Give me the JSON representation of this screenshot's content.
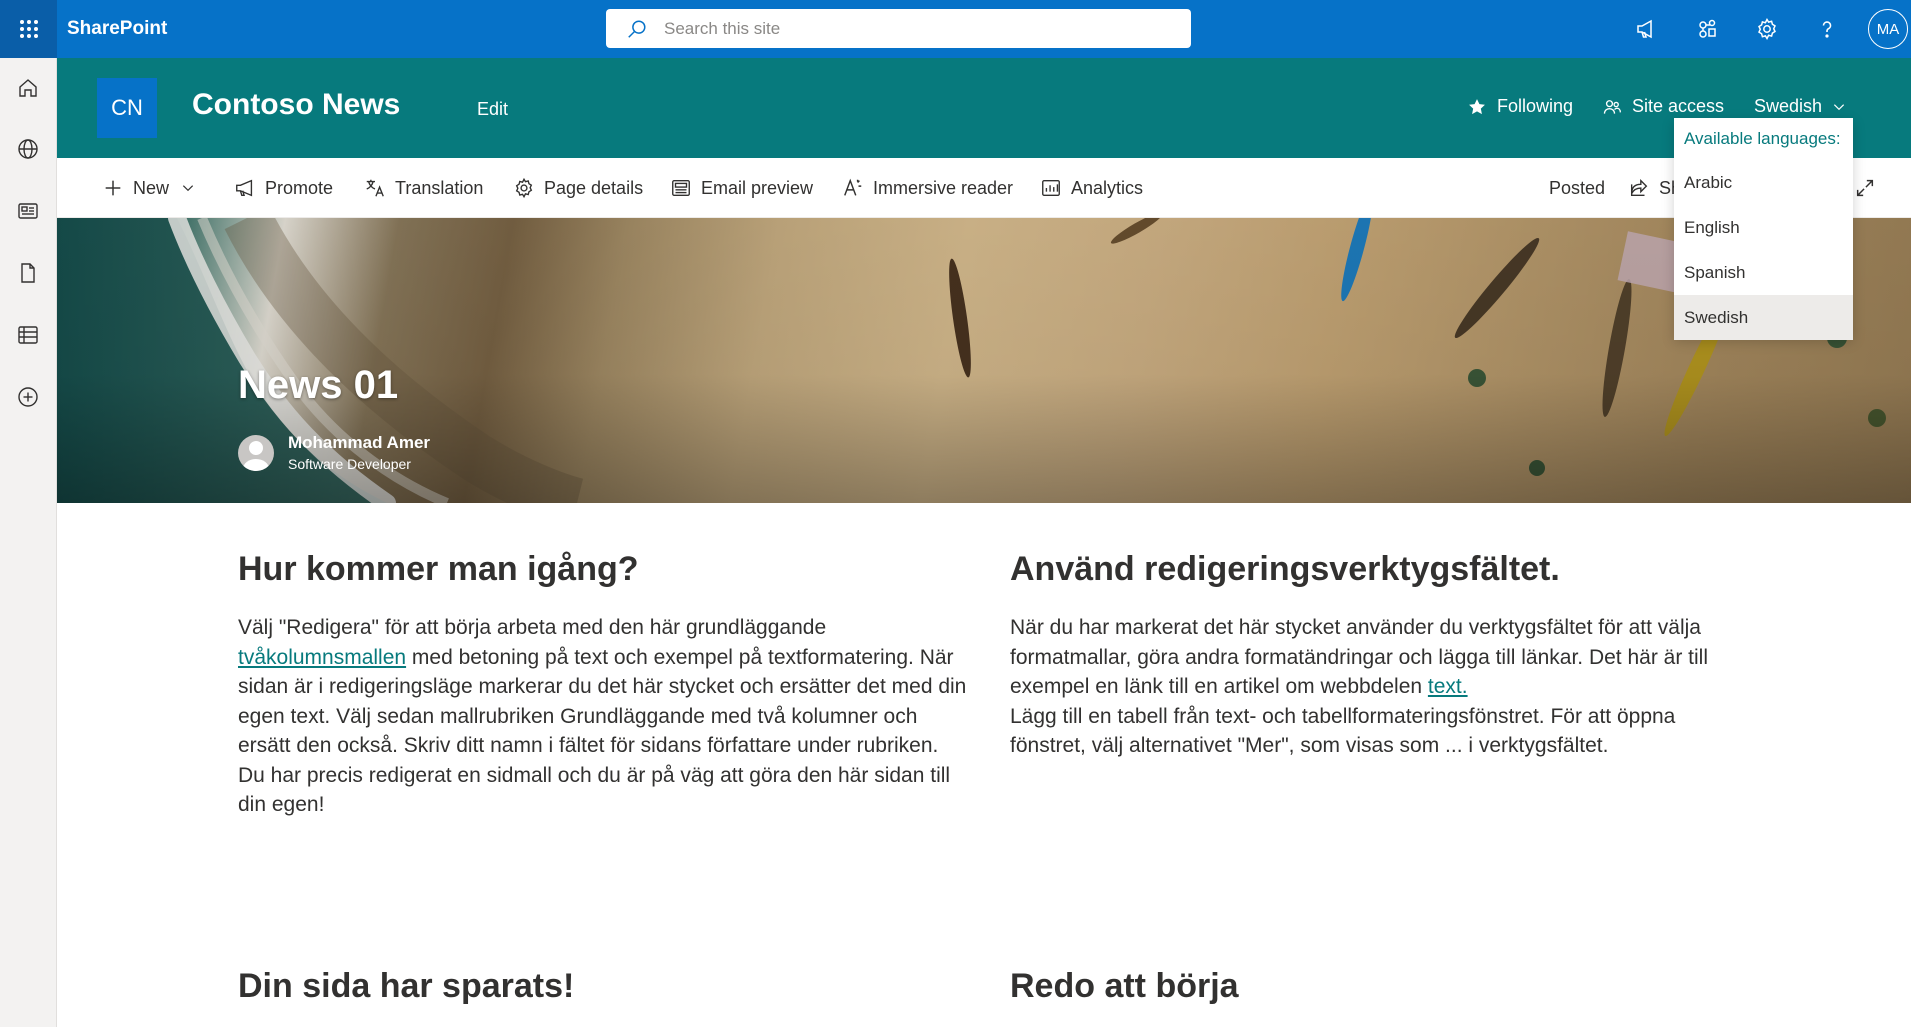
{
  "suite": {
    "brand": "SharePoint",
    "search_placeholder": "Search this site",
    "avatar_initials": "MA",
    "icons": [
      "waffle-icon",
      "megaphone-icon",
      "share-app-icon",
      "gear-icon",
      "help-icon"
    ]
  },
  "leftrail": {
    "items": [
      "home-icon",
      "globe-icon",
      "news-icon",
      "file-icon",
      "list-icon",
      "add-circle-icon"
    ]
  },
  "site": {
    "logo": "CN",
    "title": "Contoso News",
    "edit": "Edit",
    "following": "Following",
    "site_access": "Site access",
    "language": "Swedish"
  },
  "commands": {
    "new": "New",
    "promote": "Promote",
    "translation": "Translation",
    "page_details": "Page details",
    "email_preview": "Email preview",
    "immersive_reader": "Immersive reader",
    "analytics": "Analytics",
    "posted": "Posted",
    "share": "Sha"
  },
  "language_menu": {
    "header": "Available languages:",
    "options": [
      "Arabic",
      "English",
      "Spanish",
      "Swedish"
    ],
    "selected": "Swedish"
  },
  "hero": {
    "title": "News 01",
    "author_name": "Mohammad Amer",
    "author_role": "Software Developer"
  },
  "content": {
    "col1": {
      "heading": "Hur kommer man igång?",
      "p1_before": "Välj \"Redigera\" för att börja arbeta med den här grundläggande ",
      "p1_link": "tvåkolumnsmallen",
      "p1_after": " med betoning på text och exempel på textformatering. När sidan är i redigeringsläge markerar du det här stycket och ersätter det med din egen text. Välj sedan mallrubriken Grundläggande med två kolumner och ersätt den också. Skriv ditt namn i fältet för sidans författare under rubriken.",
      "p2": "Du har precis redigerat en sidmall och du är på väg att göra den här sidan till din egen!"
    },
    "col2": {
      "heading": "Använd redigeringsverktygsfältet.",
      "p1_before": "När du har markerat det här stycket använder du verktygsfältet för att välja formatmallar, göra andra formatändringar och lägga till länkar. Det här är till exempel en länk till en artikel om webbdelen  ",
      "p1_link": "text.",
      "p2": "Lägg till en tabell från text- och tabellformateringsfönstret. För att öppna fönstret, välj alternativet \"Mer\", som visas som ... i verktygsfältet."
    },
    "col3": {
      "heading": "Din sida har sparats!"
    },
    "col4": {
      "heading": "Redo att börja"
    }
  }
}
